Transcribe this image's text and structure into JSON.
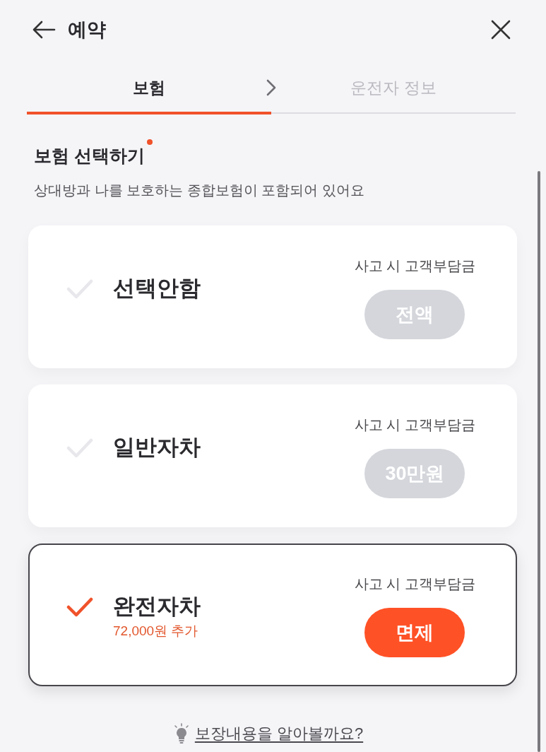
{
  "header": {
    "title": "예약"
  },
  "steps": [
    {
      "label": "보험",
      "selected": true
    },
    {
      "label": "운전자 정보",
      "selected": false
    }
  ],
  "section": {
    "title": "보험 선택하기",
    "required": true,
    "subtitle": "상대방과 나를 보호하는 종합보험이 포함되어 있어요"
  },
  "options": [
    {
      "name": "선택안함",
      "deductible_label": "사고 시 고객부담금",
      "deductible": "전액",
      "selected": false
    },
    {
      "name": "일반자차",
      "deductible_label": "사고 시 고객부담금",
      "deductible": "30만원",
      "selected": false
    },
    {
      "name": "완전자차",
      "extra": "72,000원 추가",
      "deductible_label": "사고 시 고객부담금",
      "deductible": "면제",
      "selected": true
    }
  ],
  "link": {
    "label": "보장내용을 알아볼까요?"
  }
}
